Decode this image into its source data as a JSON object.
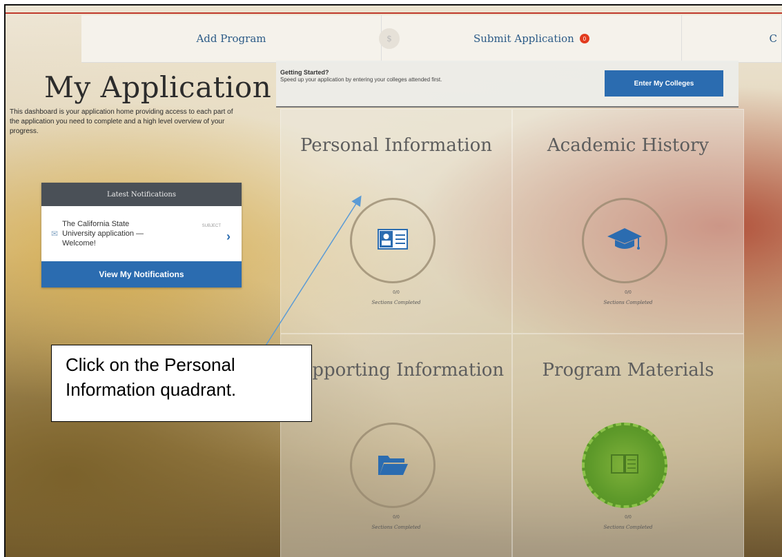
{
  "nav": {
    "add_program": "Add Program",
    "submit_application": "Submit Application",
    "submit_badge": "0",
    "partial_tab": "C"
  },
  "page_title": "My Application",
  "description": "This dashboard is your application home providing access to each part of the application you need to complete and a high level overview of your progress.",
  "notifications": {
    "header": "Latest Notifications",
    "item_text": "The California State University application — Welcome!",
    "item_tag": "SUBJECT",
    "button": "View My Notifications"
  },
  "getting_started": {
    "title": "Getting Started?",
    "subtitle": "Speed up your application by entering your colleges attended first.",
    "button": "Enter My Colleges"
  },
  "quadrants": [
    {
      "title": "Personal Information",
      "count": "0/0",
      "caption": "Sections Completed",
      "icon": "id-card-icon"
    },
    {
      "title": "Academic History",
      "count": "0/0",
      "caption": "Sections Completed",
      "icon": "graduation-cap-icon"
    },
    {
      "title": "Supporting Information",
      "count": "0/0",
      "caption": "Sections Completed",
      "icon": "folder-icon"
    },
    {
      "title": "Program Materials",
      "count": "0/0",
      "caption": "Sections Completed",
      "icon": "book-icon"
    }
  ],
  "callout": "Click on the Personal Information quadrant.",
  "colors": {
    "primary_blue": "#2b6cb0",
    "nav_text": "#2b5a86",
    "badge_red": "#e23b1e",
    "program_green": "#5e9a2a"
  }
}
